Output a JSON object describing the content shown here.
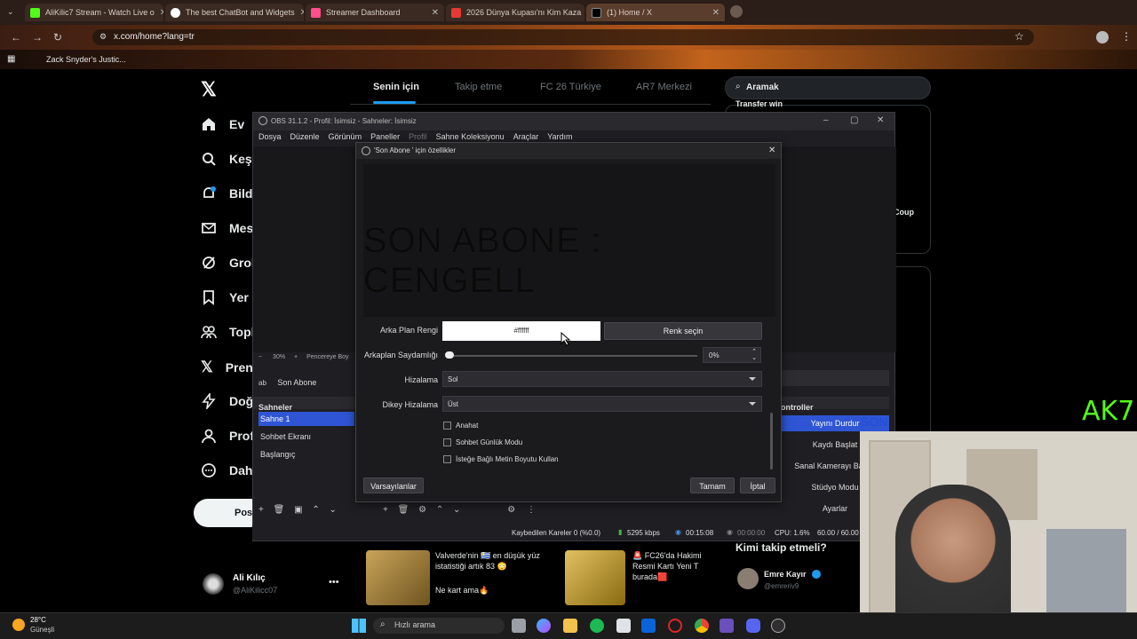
{
  "browser": {
    "tabs": [
      {
        "label": "AliKilic7 Stream - Watch Live o",
        "color": "#53fc18"
      },
      {
        "label": "The best ChatBot and Widgets",
        "color": "#ffffff"
      },
      {
        "label": "Streamer Dashboard",
        "color": "#ff4d8d"
      },
      {
        "label": "2026 Dünya Kupası'nı Kim Kaza",
        "color": "#e53935"
      },
      {
        "label": "(1) Home / X",
        "color": "#000000"
      }
    ],
    "address": "x.com/home?lang=tr",
    "bookmark": "Zack Snyder's Justic..."
  },
  "x": {
    "nav": [
      "Ev",
      "Keşf",
      "Bildi",
      "Mes",
      "Grok",
      "Yer i",
      "Topl",
      "Pren",
      "Doğ",
      "Prof",
      "Daha"
    ],
    "post_button": "Pos",
    "tabs": [
      "Senin için",
      "Takip etme",
      "FC 26 Türkiye",
      "AR7 Merkezi"
    ],
    "search_placeholder": "Aramak",
    "trend_top": "Transfer win",
    "trend_coup": "Coup",
    "profile_name": "Ali Kılıç",
    "profile_handle": "@AliKilicc07",
    "who_to_follow": "Kimi takip etmeli?",
    "follow_name": "Emre Kayır",
    "follow_handle": "@emreriv9",
    "feed1_text": "Valverde'nin 🇺🇾 en düşük yüz istatistiği artık 83 😳",
    "feed1_sub": "Ne kart ama🔥",
    "feed2_text": "🚨 FC26'da Hakimi Resmi Kartı Yeni T burada🟥",
    "overlay_ak": "AK7"
  },
  "obs": {
    "title": "OBS 31.1.2 - Profil: İsimsiz - Sahneler: İsimsiz",
    "menu": [
      "Dosya",
      "Düzenle",
      "Görünüm",
      "Paneller",
      "Profil",
      "Sahne Koleksiyonu",
      "Araçlar",
      "Yardım"
    ],
    "zoom": "30%",
    "zoom_label": "Pencereye Boy",
    "source_name": "Son Abone",
    "scenes_title": "Sahneler",
    "scenes": [
      "Sahne 1",
      "Sohbet Ekranı",
      "Başlangıç"
    ],
    "controls_title": "ontroller",
    "controls": [
      "Yayını Durdur",
      "Kaydı Başlat",
      "Sanal Kamerayı Başlat",
      "Stüdyo Modu",
      "Ayarlar"
    ],
    "son_text": "SON",
    "status": {
      "dropped": "Kaybedilen Kareler 0 (%0.0)",
      "bitrate": "5295 kbps",
      "live_time": "00:15:08",
      "rec_time": "00:00:00",
      "cpu": "CPU: 1.6%",
      "fps": "60.00 / 60.00"
    }
  },
  "dialog": {
    "title": "'Son Abone ' için özellikler",
    "preview_text": "SON ABONE : CENGELL",
    "bg_color_label": "Arka Plan Rengi",
    "bg_color_value": "#ffffff",
    "pick_color": "Renk seçin",
    "opacity_label": "Arkaplan Saydamlığı",
    "opacity_value": "0%",
    "opacity": 0,
    "align_label": "Hizalama",
    "align_value": "Sol",
    "valign_label": "Dikey Hizalama",
    "valign_value": "Üst",
    "checks": [
      "Anahat",
      "Sohbet Günlük Modu",
      "İsteğe Bağlı Metin Boyutu Kullan"
    ],
    "defaults": "Varsayılanlar",
    "ok": "Tamam",
    "cancel": "İptal"
  },
  "taskbar": {
    "weather_temp": "28°C",
    "weather_desc": "Güneşli",
    "search": "Hızlı arama"
  }
}
